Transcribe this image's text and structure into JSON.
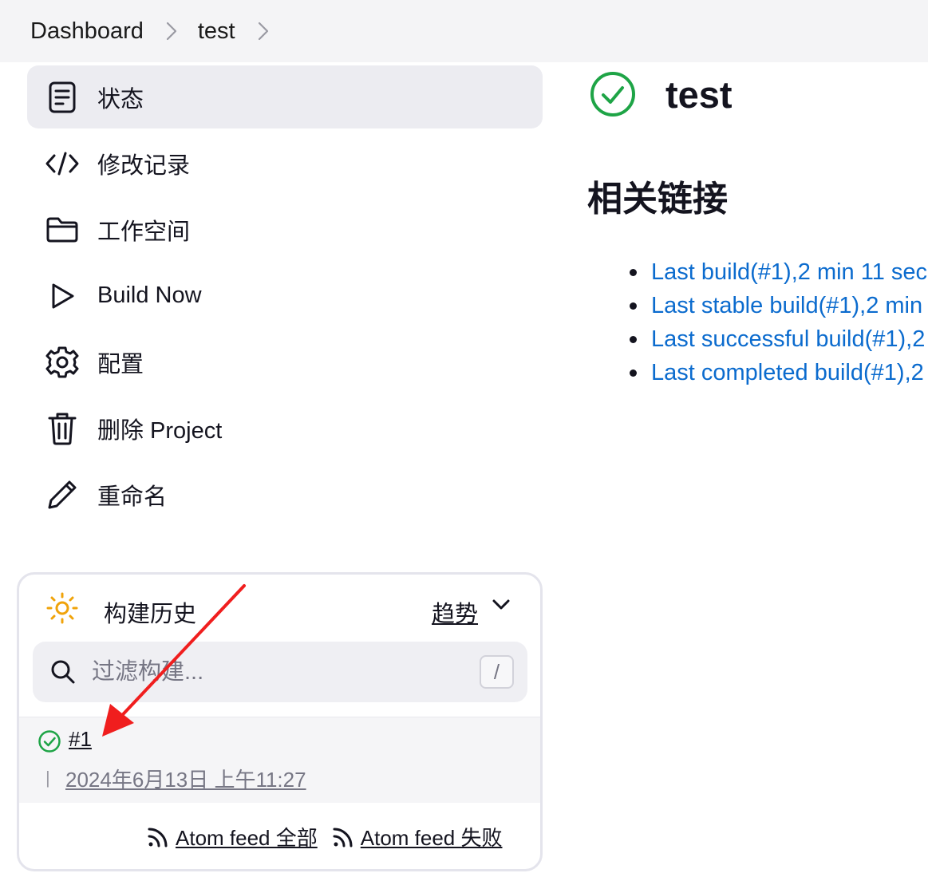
{
  "breadcrumb": {
    "items": [
      "Dashboard",
      "test"
    ]
  },
  "side_menu": {
    "items": [
      {
        "label": "状态",
        "icon": "document-icon",
        "active": true
      },
      {
        "label": "修改记录",
        "icon": "code-icon"
      },
      {
        "label": "工作空间",
        "icon": "folder-icon"
      },
      {
        "label": "Build Now",
        "icon": "play-icon"
      },
      {
        "label": "配置",
        "icon": "gear-icon"
      },
      {
        "label": "删除 Project",
        "icon": "trash-icon"
      },
      {
        "label": "重命名",
        "icon": "pencil-icon"
      }
    ]
  },
  "build_history": {
    "title": "构建历史",
    "trend_label": "趋势",
    "search_placeholder": "过滤构建...",
    "shortcut_key": "/",
    "builds": [
      {
        "number": "#1",
        "date": "2024年6月13日 上午11:27",
        "status": "success"
      }
    ],
    "feeds": [
      {
        "label": "Atom feed 全部"
      },
      {
        "label": "Atom feed 失败"
      }
    ]
  },
  "main": {
    "project_name": "test",
    "status": "success",
    "section_title": "相关链接",
    "links": [
      "Last build(#1),2 min 11 sec",
      "Last stable build(#1),2 min",
      "Last successful build(#1),2",
      "Last completed build(#1),2"
    ]
  },
  "colors": {
    "link": "#0b6bce",
    "success": "#1ea446",
    "active_bg": "#ececf1",
    "arrow": "#f01e1e"
  }
}
